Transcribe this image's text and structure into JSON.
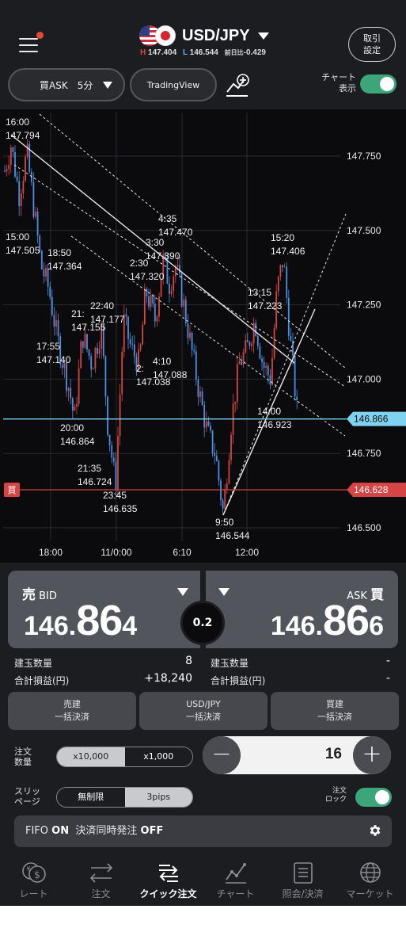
{
  "header": {
    "pair": "USD/JPY",
    "high_label": "H",
    "high": "147.404",
    "low_label": "L",
    "low": "146.544",
    "change_label": "前日比",
    "change": "-0.429",
    "trade_settings": "取引",
    "trade_settings2": "設定",
    "interval": "買ASK　5分",
    "tradingview": "TradingView",
    "chart_toggle": "チャート",
    "chart_toggle2": "表示"
  },
  "chart_data": {
    "type": "candlestick",
    "title": "",
    "y_ticks": [
      "147.750",
      "147.500",
      "147.250",
      "147.000",
      "146.750",
      "146.500"
    ],
    "x_ticks": [
      "18:00",
      "11/0:00",
      "6:10",
      "12:00"
    ],
    "current_bid": "146.866",
    "position_label": "買",
    "position_price": "146.628",
    "annotations": [
      {
        "time": "16:00",
        "price": "147.794"
      },
      {
        "time": "15:00",
        "price": "147.505"
      },
      {
        "time": "18:50",
        "price": "147.364"
      },
      {
        "time": "21:",
        "price": "147.155"
      },
      {
        "time": "22:40",
        "price": "147.177"
      },
      {
        "time": "17:55",
        "price": "147.140"
      },
      {
        "time": "20:00",
        "price": "146.864"
      },
      {
        "time": "21:35",
        "price": "146.724"
      },
      {
        "time": "23:45",
        "price": "146.635"
      },
      {
        "time": "4:35",
        "price": "147.470"
      },
      {
        "time": "3:30",
        "price": "147.390"
      },
      {
        "time": "2:30",
        "price": "147.320"
      },
      {
        "time": "4:10",
        "price": "147.088"
      },
      {
        "time": "2:",
        "price": "147.038"
      },
      {
        "time": "9:50",
        "price": "146.544"
      },
      {
        "time": "15:20",
        "price": "147.406"
      },
      {
        "time": "13:15",
        "price": "147.223"
      },
      {
        "time": "14:00",
        "price": "146.923"
      }
    ],
    "colors": {
      "up": "#d64545",
      "down": "#4a90e2",
      "bid_line": "#7fd3f0",
      "position_line": "#d64545"
    }
  },
  "trade": {
    "bid_label": "売",
    "bid_sub": "BID",
    "bid_price_a": "146.",
    "bid_price_b": "86",
    "bid_price_c": "4",
    "ask_label": "買",
    "ask_sub": "ASK",
    "ask_price_a": "146.",
    "ask_price_b": "86",
    "ask_price_c": "6",
    "spread": "0.2",
    "positions_label": "建玉数量",
    "positions_value": "8",
    "pnl_label": "合計損益(円)",
    "pnl_value": "+18,240",
    "positions_label_r": "建玉数量",
    "positions_value_r": "-",
    "pnl_label_r": "合計損益(円)",
    "pnl_value_r": "-",
    "close_sell": "売建",
    "close_sell_sub": "一括決済",
    "close_pair": "USD/JPY",
    "close_pair_sub": "一括決済",
    "close_buy": "買建",
    "close_buy_sub": "一括決済",
    "qty_label": "注文",
    "qty_label2": "数量",
    "unit_a": "x10,000",
    "unit_b": "x1,000",
    "qty": "16",
    "minus": "−",
    "plus": "+",
    "slip_label": "スリッ",
    "slip_label2": "ページ",
    "slip_a": "無制限",
    "slip_b": "3pips",
    "lock_label": "注文",
    "lock_label2": "ロック",
    "fifo_label": "FIFO",
    "fifo_value": "ON",
    "simul_label": "決済同時発注",
    "simul_value": "OFF"
  },
  "tabs": [
    {
      "label": "レート",
      "icon": "yen-dollar-icon"
    },
    {
      "label": "注文",
      "icon": "arrows-icon"
    },
    {
      "label": "クイック注文",
      "icon": "quick-order-icon"
    },
    {
      "label": "チャート",
      "icon": "chart-icon"
    },
    {
      "label": "照会/決済",
      "icon": "list-icon"
    },
    {
      "label": "マーケット",
      "icon": "globe-icon"
    }
  ]
}
